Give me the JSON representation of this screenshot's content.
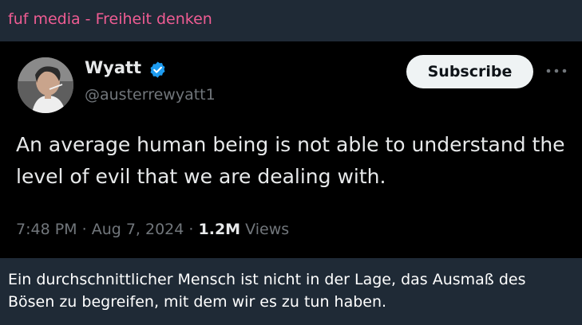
{
  "channel": {
    "name": "fuf media - Freiheit denken"
  },
  "tweet": {
    "author_name": "Wyatt",
    "author_handle": "@austerrewyatt1",
    "subscribe_label": "Subscribe",
    "text": "An average human being is not able to understand the level of evil that we are dealing with.",
    "time": "7:48 PM",
    "date": "Aug 7, 2024",
    "views_count": "1.2M",
    "views_label": "Views",
    "separator": "·",
    "verified_icon": "verified-badge-icon",
    "more_icon": "more-options-icon"
  },
  "message": {
    "translation": "Ein durchschnittlicher Mensch ist nicht in der Lage, das Ausmaß des Bösen zu begreifen, mit dem wir es zu tun haben."
  },
  "colors": {
    "channel_name": "#ef5c93",
    "verified": "#1d9bf0",
    "tweet_background": "#000000",
    "chat_background": "#1f2a36"
  }
}
